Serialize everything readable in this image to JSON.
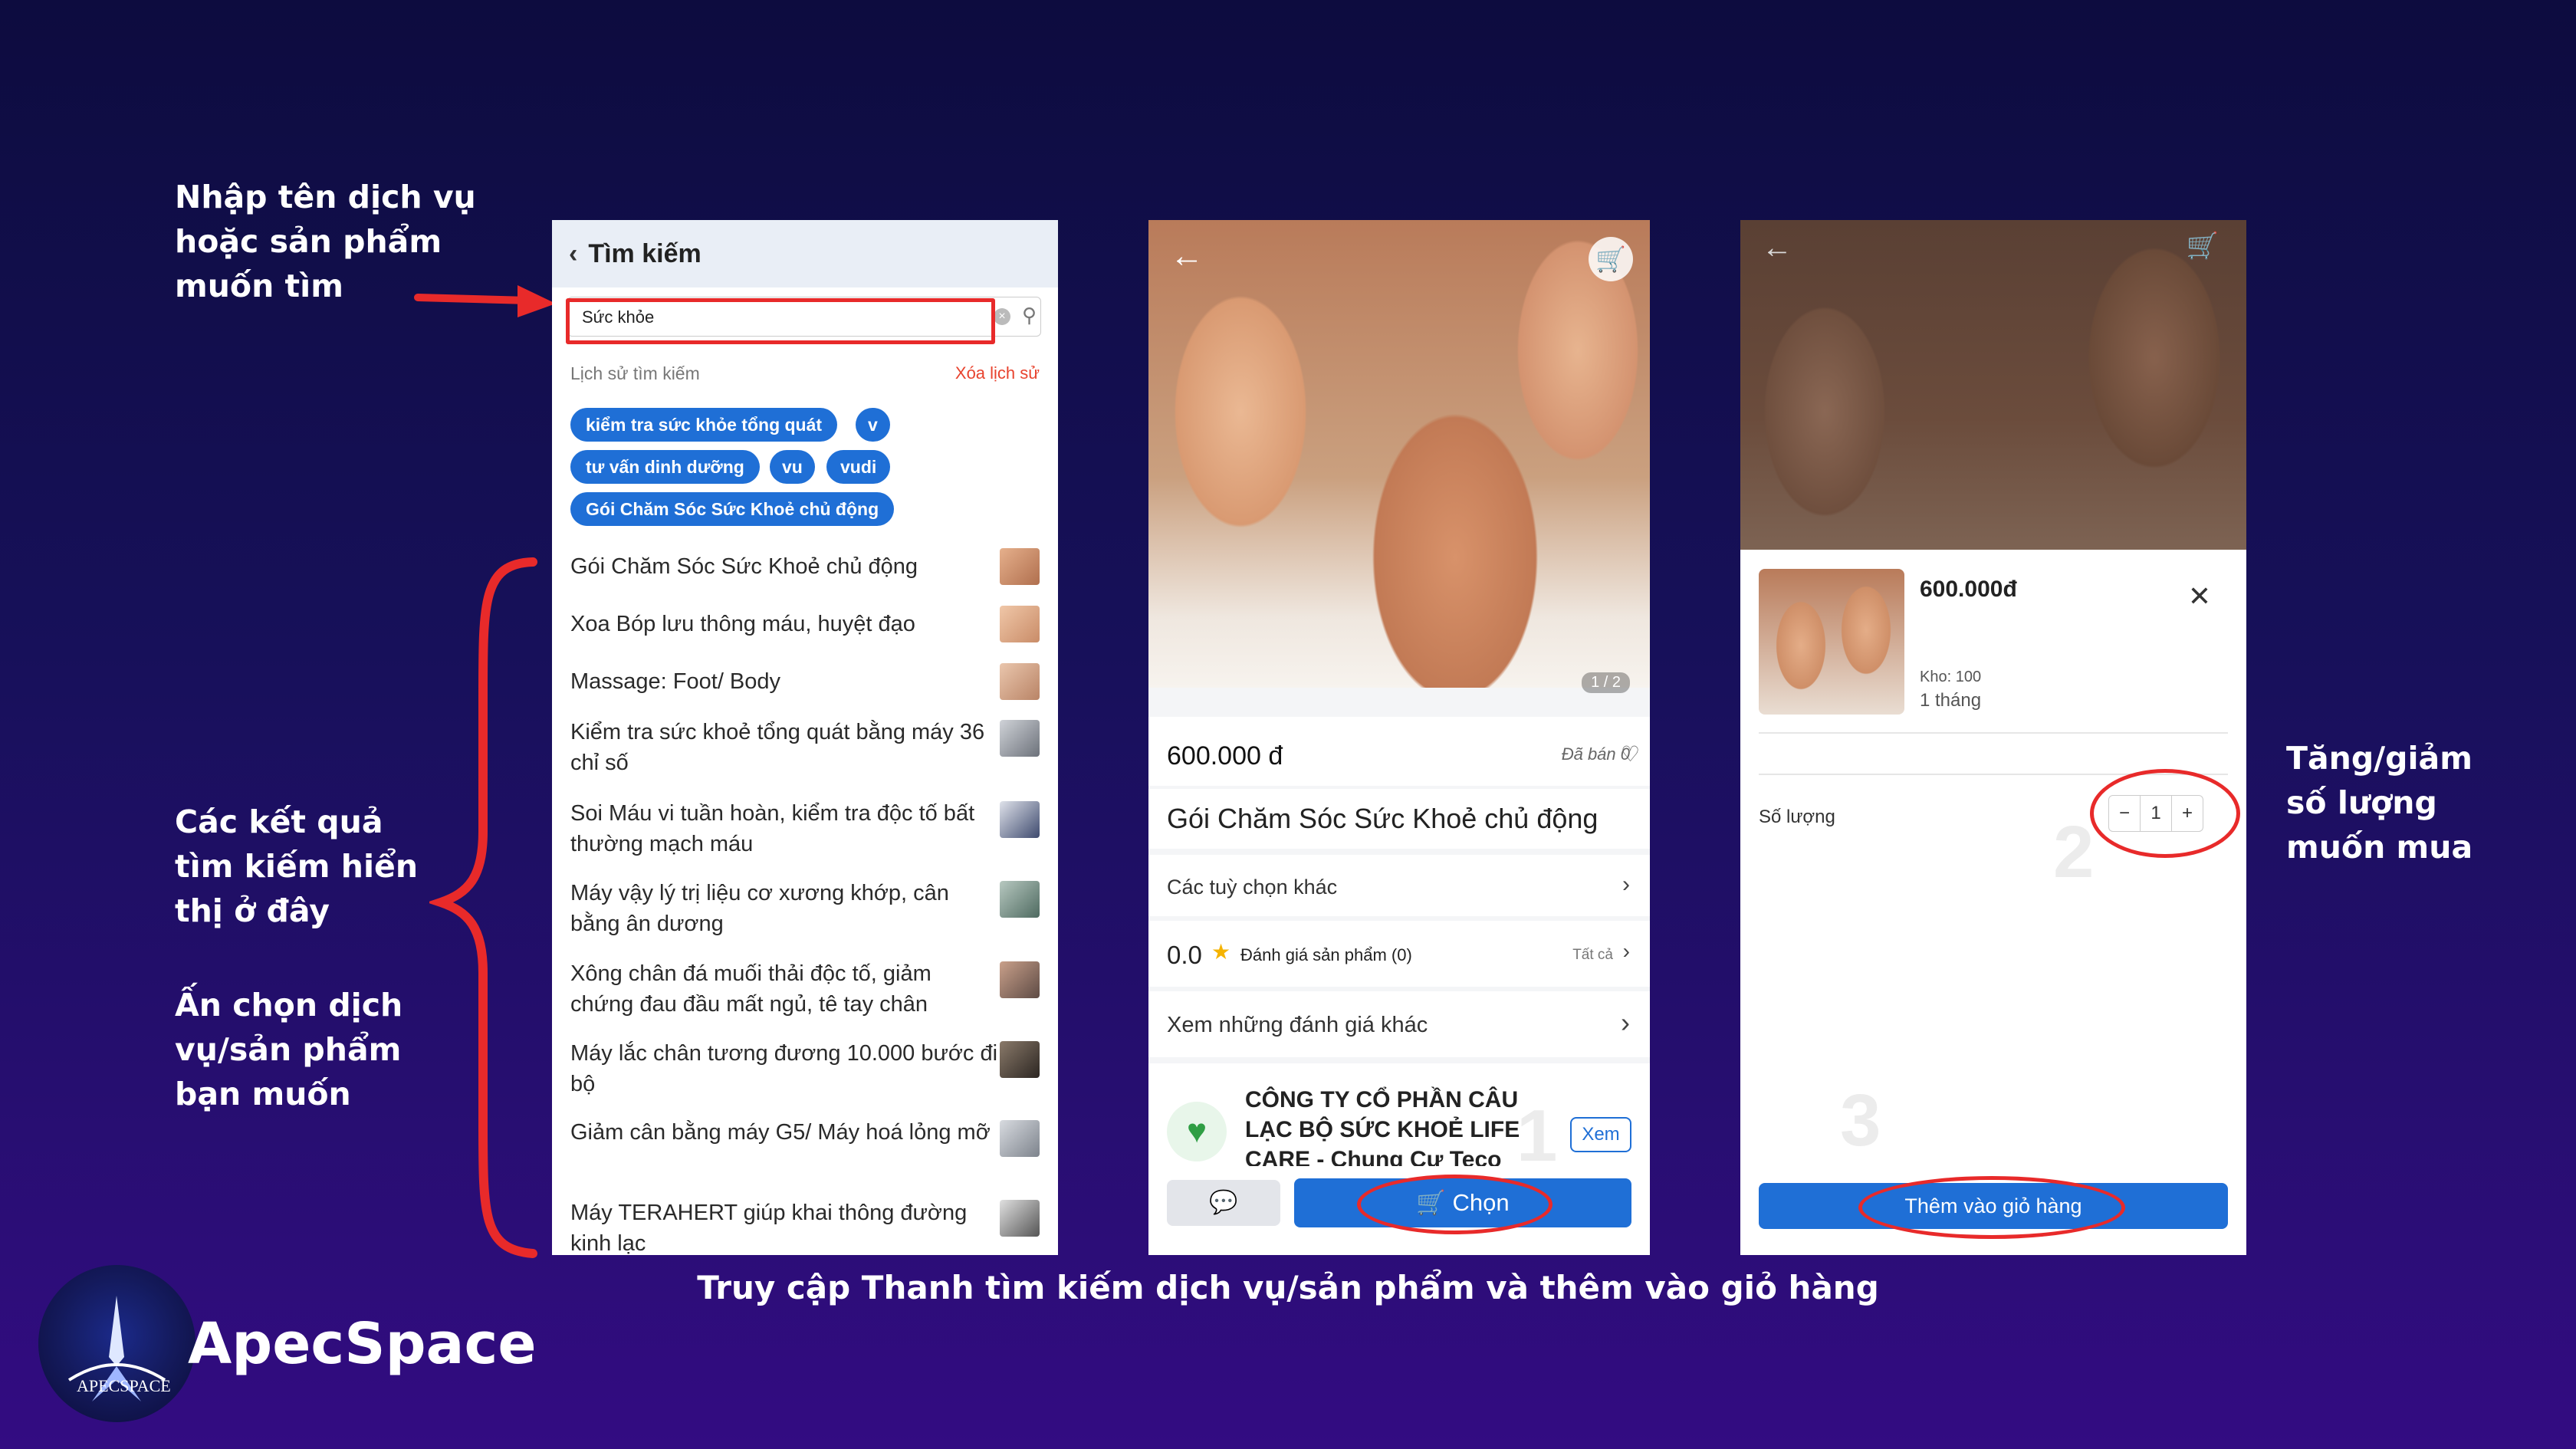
{
  "annotations": {
    "left_top": "Nhập tên dịch vụ\nhoặc sản phẩm\nmuốn tìm",
    "left_results": "Các  kết  quả\ntìm kiếm hiển\nthị ở đây",
    "left_choose": "Ấn chọn dịch\nvụ/sản phẩm\nbạn muốn",
    "right_qty": "Tăng/giảm\nsố lượng\nmuốn mua",
    "caption": "Truy cập Thanh tìm kiếm dịch vụ/sản phẩm và thêm vào giỏ hàng"
  },
  "brand": {
    "name": "ApecSpace",
    "logo_text": "APECSPACE"
  },
  "screen1": {
    "title": "Tìm kiếm",
    "search_value": "Sức khỏe",
    "history_label": "Lịch sử tìm kiếm",
    "clear_history": "Xóa lịch sử",
    "chips": [
      "kiểm tra sức khỏe tổng quát",
      "v",
      "tư vấn dinh dưỡng",
      "vu",
      "vudi",
      "Gói Chăm Sóc Sức Khoẻ chủ động"
    ],
    "results": [
      "Gói Chăm Sóc Sức Khoẻ chủ động",
      "Xoa Bóp lưu thông máu, huyệt đạo",
      "Massage: Foot/ Body",
      "Kiểm tra sức khoẻ tổng quát bằng máy 36 chỉ số",
      "Soi Máu vi tuần hoàn, kiểm tra độc tố bất thường mạch máu",
      "Máy vậy lý trị liệu cơ xương khớp, cân bằng ân dương",
      "Xông chân đá muối thải độc tố, giảm chứng đau đầu mất ngủ, tê tay chân",
      "Máy lắc chân tương đương 10.000 bước đi bộ",
      "Giảm cân bằng máy G5/ Máy hoá lỏng mỡ",
      "Máy TERAHERT giúp khai thông đường kinh lạc"
    ]
  },
  "screen2": {
    "image_counter": "1 / 2",
    "price": "600.000 đ",
    "sold": "Đã bán 0",
    "product_name": "Gói Chăm Sóc Sức Khoẻ chủ động",
    "options_label": "Các tuỳ chọn khác",
    "rating_value": "0.0",
    "rating_label": "Đánh giá sản phẩm (0)",
    "rating_all": "Tất cả",
    "reviews_label": "Xem những đánh giá khác",
    "company": "CÔNG TY CỔ PHẦN CÂU LẠC BỘ SỨC KHOẺ LIFE CARE - Chung Cư Teco",
    "view_button": "Xem",
    "choose_button": "Chọn",
    "step_number": "1"
  },
  "screen3": {
    "price": "600.000đ",
    "stock": "Kho: 100",
    "duration": "1 tháng",
    "quantity_label": "Số lượng",
    "quantity_value": "1",
    "minus": "−",
    "plus": "+",
    "add_to_cart": "Thêm vào giỏ hàng",
    "step2": "2",
    "step3": "3"
  }
}
